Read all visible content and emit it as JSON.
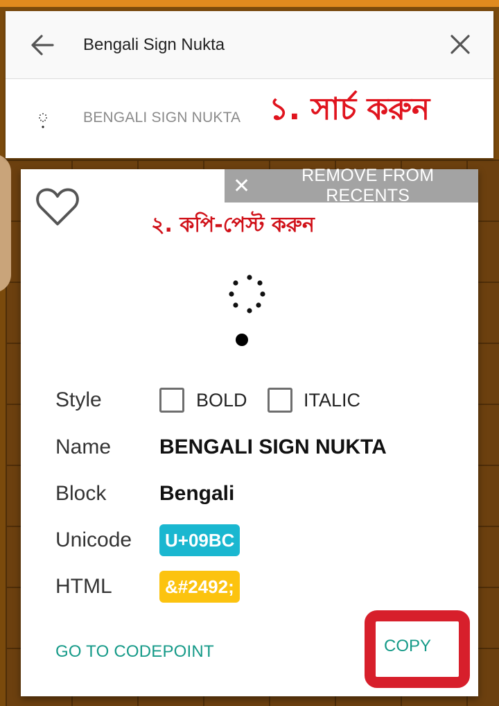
{
  "search": {
    "query": "Bengali Sign Nukta",
    "result_glyph_icon": "nukta-dots-icon",
    "result_label": "BENGALI SIGN NUKTA"
  },
  "annotations": {
    "step1": "১. সার্চ করুন",
    "step2": "২. কপি-পেস্ট করুন"
  },
  "dialog": {
    "remove_label": "REMOVE FROM RECENTS",
    "style_key": "Style",
    "bold_label": "BOLD",
    "italic_label": "ITALIC",
    "name_key": "Name",
    "name_value": "BENGALI SIGN NUKTA",
    "block_key": "Block",
    "block_value": "Bengali",
    "unicode_key": "Unicode",
    "unicode_value": "U+09BC",
    "html_key": "HTML",
    "html_value": "&#2492;",
    "goto_label": "GO TO CODEPOINT",
    "copy_label": "COPY"
  },
  "colors": {
    "accent_teal": "#159a88",
    "unicode_chip": "#1ab7d0",
    "html_chip": "#fcc30f",
    "annotation_red": "#e0141e",
    "highlight_frame": "#d71f2b"
  }
}
